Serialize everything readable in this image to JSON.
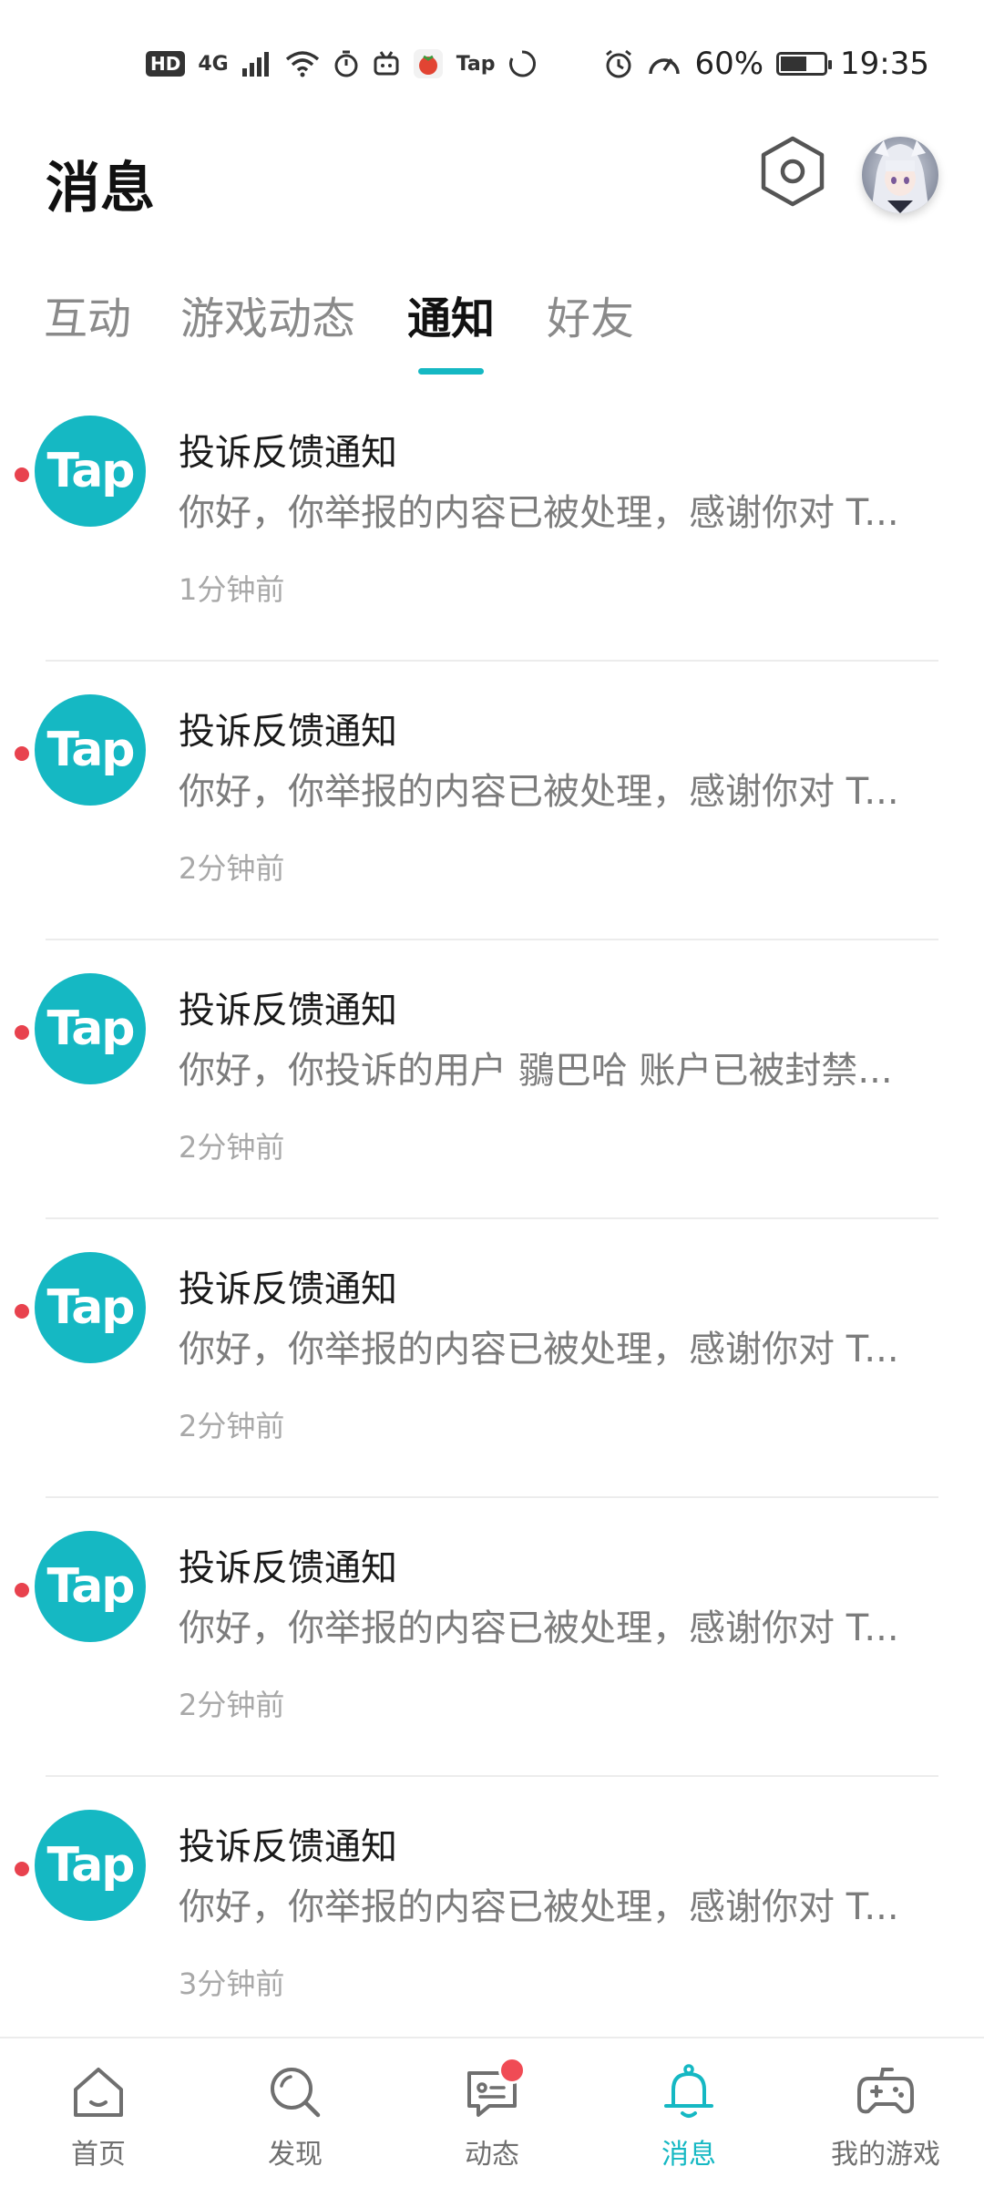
{
  "status_bar": {
    "hd": "HD",
    "network": "4G",
    "tap_label": "Tap",
    "battery_percent": "60%",
    "battery_level": 0.6,
    "time": "19:35"
  },
  "header": {
    "title": "消息"
  },
  "tabs": [
    {
      "label": "互动",
      "active": false
    },
    {
      "label": "游戏动态",
      "active": false
    },
    {
      "label": "通知",
      "active": true
    },
    {
      "label": "好友",
      "active": false
    }
  ],
  "notifications": [
    {
      "avatar_text": "Tap",
      "title": "投诉反馈通知",
      "preview": "你好，你举报的内容已被处理，感谢你对 T...",
      "time": "1分钟前",
      "unread": true
    },
    {
      "avatar_text": "Tap",
      "title": "投诉反馈通知",
      "preview": "你好，你举报的内容已被处理，感谢你对 T...",
      "time": "2分钟前",
      "unread": true
    },
    {
      "avatar_text": "Tap",
      "title": "投诉反馈通知",
      "preview": "你好，你投诉的用户 鶸巴哈 账户已被封禁...",
      "time": "2分钟前",
      "unread": true
    },
    {
      "avatar_text": "Tap",
      "title": "投诉反馈通知",
      "preview": "你好，你举报的内容已被处理，感谢你对 T...",
      "time": "2分钟前",
      "unread": true
    },
    {
      "avatar_text": "Tap",
      "title": "投诉反馈通知",
      "preview": "你好，你举报的内容已被处理，感谢你对 T...",
      "time": "2分钟前",
      "unread": true
    },
    {
      "avatar_text": "Tap",
      "title": "投诉反馈通知",
      "preview": "你好，你举报的内容已被处理，感谢你对 T...",
      "time": "3分钟前",
      "unread": true
    }
  ],
  "bottom_nav": [
    {
      "label": "首页",
      "icon": "home-icon",
      "active": false,
      "badge": false
    },
    {
      "label": "发现",
      "icon": "search-icon",
      "active": false,
      "badge": false
    },
    {
      "label": "动态",
      "icon": "chat-icon",
      "active": false,
      "badge": true
    },
    {
      "label": "消息",
      "icon": "bell-icon",
      "active": true,
      "badge": false
    },
    {
      "label": "我的游戏",
      "icon": "gamepad-icon",
      "active": false,
      "badge": false
    }
  ],
  "colors": {
    "accent": "#15b8c3",
    "unread_dot": "#e8424e",
    "badge": "#f04b55"
  }
}
